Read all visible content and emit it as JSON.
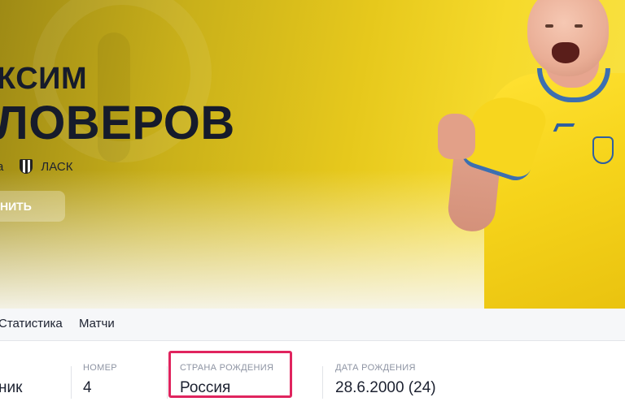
{
  "player": {
    "first_name": "КСИМ",
    "last_name": "ЛОВЕРОВ",
    "country_short": "а",
    "club": "ЛАСК",
    "action_label": "НИТЬ"
  },
  "tabs": [
    {
      "label": "Статистика"
    },
    {
      "label": "Матчи"
    }
  ],
  "info": {
    "position_value": "ник",
    "number_label": "НОМЕР",
    "number_value": "4",
    "birth_country_label": "СТРАНА РОЖДЕНИЯ",
    "birth_country_value": "Россия",
    "birth_date_label": "ДАТА РОЖДЕНИЯ",
    "birth_date_value": "28.6.2000 (24)"
  },
  "colors": {
    "hero_yellow": "#f6da2b",
    "highlight": "#e0245e",
    "text_dark": "#1c2130",
    "label_gray": "#8e94a3"
  }
}
